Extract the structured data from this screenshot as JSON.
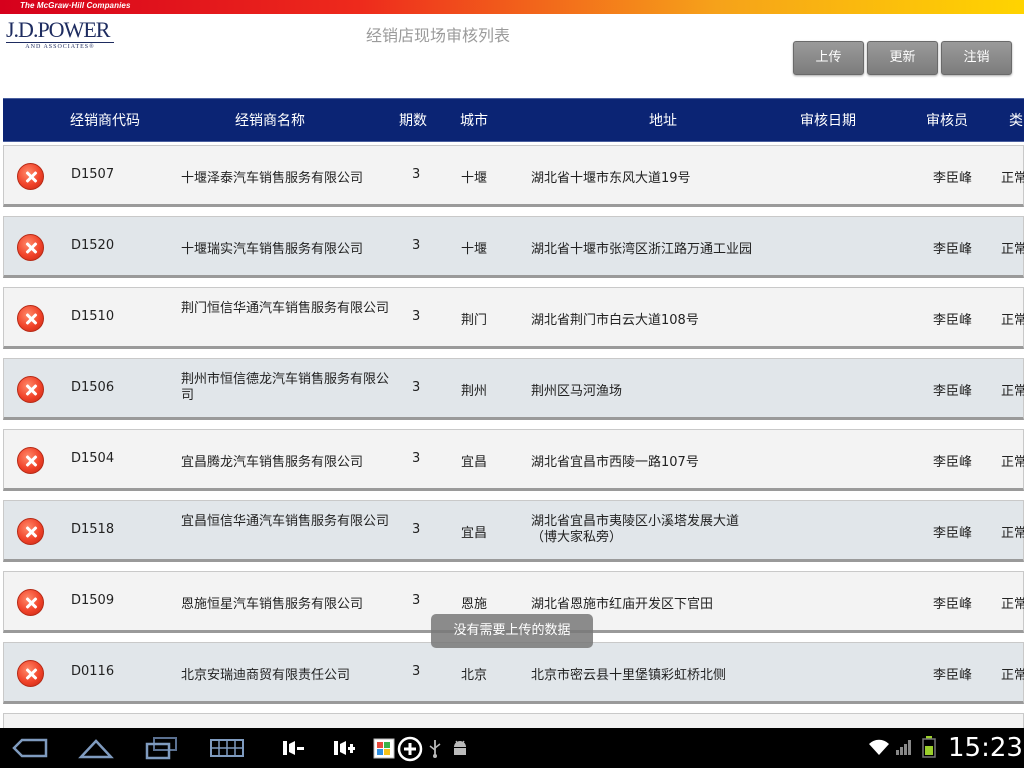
{
  "brand": {
    "strip_text": "The McGraw·Hill Companies",
    "logo_main": "J.D.POWER",
    "logo_sub": "AND ASSOCIATES®"
  },
  "header": {
    "title": "经销店现场审核列表"
  },
  "toolbar": {
    "upload_label": "上传",
    "update_label": "更新",
    "logout_label": "注销"
  },
  "table": {
    "columns": [
      "经销商代码",
      "经销商名称",
      "期数",
      "城市",
      "地址",
      "审核日期",
      "审核员",
      "类"
    ],
    "rows": [
      {
        "code": "D1507",
        "name": "十堰泽泰汽车销售服务有限公司",
        "period": "3",
        "city": "十堰",
        "address": "湖北省十堰市东风大道19号",
        "date": "",
        "auditor": "李臣峰",
        "type": "正常"
      },
      {
        "code": "D1520",
        "name": "十堰瑞实汽车销售服务有限公司",
        "period": "3",
        "city": "十堰",
        "address": "湖北省十堰市张湾区浙江路万通工业园",
        "date": "",
        "auditor": "李臣峰",
        "type": "正常"
      },
      {
        "code": "D1510",
        "name": "荆门恒信华通汽车销售服务有限公司",
        "period": "3",
        "city": "荆门",
        "address": "湖北省荆门市白云大道108号",
        "date": "",
        "auditor": "李臣峰",
        "type": "正常"
      },
      {
        "code": "D1506",
        "name": "荆州市恒信德龙汽车销售服务有限公司",
        "period": "3",
        "city": "荆州",
        "address": "荆州区马河渔场",
        "date": "",
        "auditor": "李臣峰",
        "type": "正常"
      },
      {
        "code": "D1504",
        "name": "宜昌腾龙汽车销售服务有限公司",
        "period": "3",
        "city": "宜昌",
        "address": "湖北省宜昌市西陵一路107号",
        "date": "",
        "auditor": "李臣峰",
        "type": "正常"
      },
      {
        "code": "D1518",
        "name": "宜昌恒信华通汽车销售服务有限公司",
        "period": "3",
        "city": "宜昌",
        "address": "湖北省宜昌市夷陵区小溪塔发展大道（博大家私旁）",
        "date": "",
        "auditor": "李臣峰",
        "type": "正常"
      },
      {
        "code": "D1509",
        "name": "恩施恒星汽车销售服务有限公司",
        "period": "3",
        "city": "恩施",
        "address": "湖北省恩施市红庙开发区下官田",
        "date": "",
        "auditor": "李臣峰",
        "type": "正常"
      },
      {
        "code": "D0116",
        "name": "北京安瑞迪商贸有限责任公司",
        "period": "3",
        "city": "北京",
        "address": "北京市密云县十里堡镇彩虹桥北侧",
        "date": "",
        "auditor": "李臣峰",
        "type": "正常"
      }
    ]
  },
  "toast": {
    "message": "没有需要上传的数据"
  },
  "system_bar": {
    "clock": "15:23",
    "icons": [
      "back-icon",
      "home-icon",
      "recent-apps-icon",
      "keyboard-icon",
      "volume-down-icon",
      "volume-up-icon",
      "gallery-icon",
      "add-icon",
      "usb-icon",
      "android-debug-icon",
      "wifi-icon",
      "signal-icon",
      "battery-icon"
    ]
  }
}
